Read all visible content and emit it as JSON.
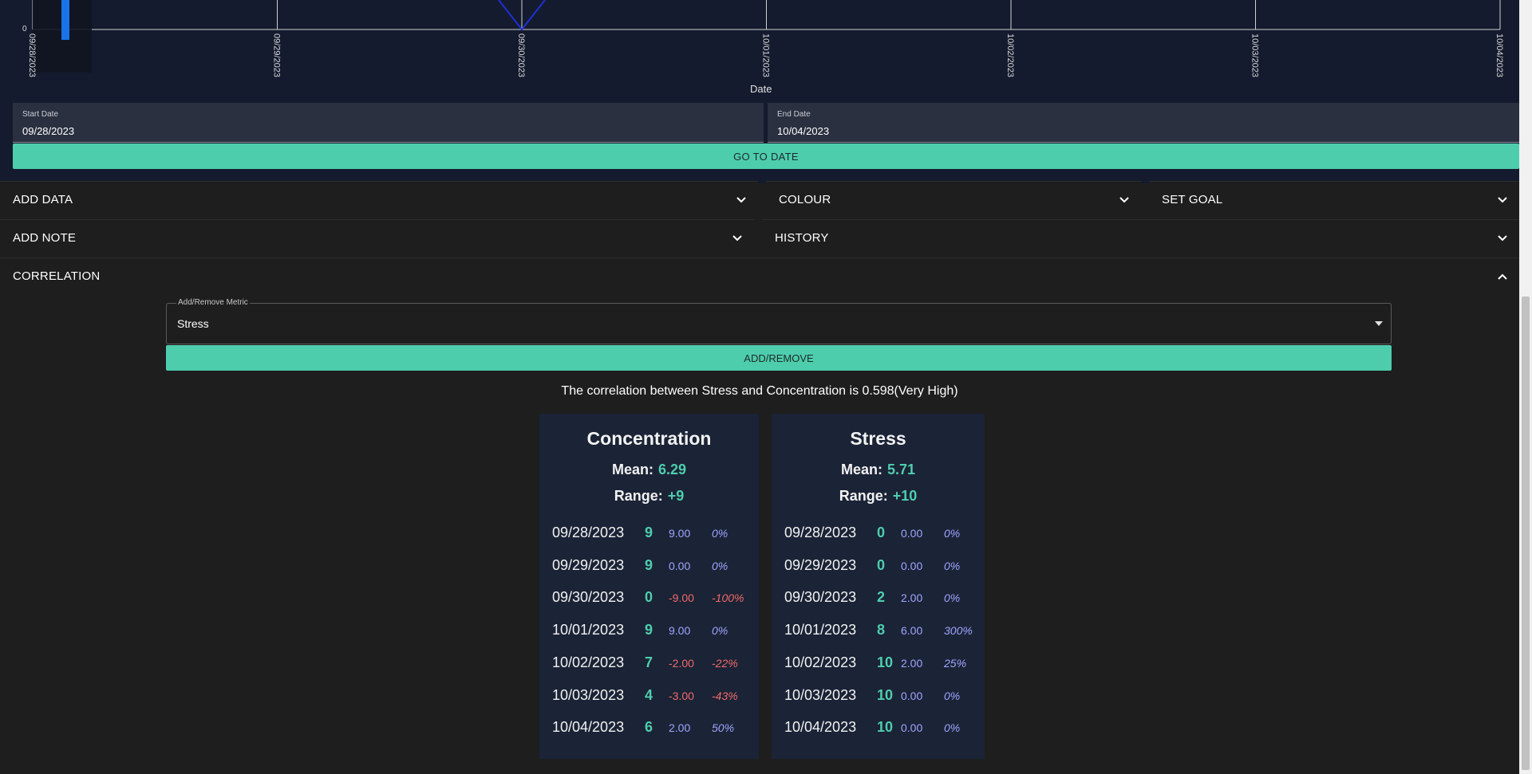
{
  "chart": {
    "zero_label": "0",
    "x_title": "Date",
    "ticks": [
      "09/28/2023",
      "09/29/2023",
      "09/30/2023",
      "10/01/2023",
      "10/02/2023",
      "10/03/2023",
      "10/04/2023"
    ]
  },
  "date_range": {
    "start_label": "Start Date",
    "start_value": "09/28/2023",
    "end_label": "End Date",
    "end_value": "10/04/2023",
    "go_label": "GO TO DATE"
  },
  "accordion": {
    "add_data": "ADD DATA",
    "colour": "COLOUR",
    "set_goal": "SET GOAL",
    "add_note": "ADD NOTE",
    "history": "HISTORY",
    "correlation": "CORRELATION"
  },
  "correlation": {
    "select_label": "Add/Remove Metric",
    "select_value": "Stress",
    "button_label": "ADD/REMOVE",
    "summary": "The correlation between Stress and Concentration is 0.598(Very High)",
    "cards": [
      {
        "title": "Concentration",
        "mean_label": "Mean:",
        "mean": "6.29",
        "range_label": "Range:",
        "range": "+9",
        "rows": [
          {
            "date": "09/28/2023",
            "value": "9",
            "change": "9.00",
            "pct": "0%",
            "neg": false
          },
          {
            "date": "09/29/2023",
            "value": "9",
            "change": "0.00",
            "pct": "0%",
            "neg": false
          },
          {
            "date": "09/30/2023",
            "value": "0",
            "change": "-9.00",
            "pct": "-100%",
            "neg": true
          },
          {
            "date": "10/01/2023",
            "value": "9",
            "change": "9.00",
            "pct": "0%",
            "neg": false
          },
          {
            "date": "10/02/2023",
            "value": "7",
            "change": "-2.00",
            "pct": "-22%",
            "neg": true
          },
          {
            "date": "10/03/2023",
            "value": "4",
            "change": "-3.00",
            "pct": "-43%",
            "neg": true
          },
          {
            "date": "10/04/2023",
            "value": "6",
            "change": "2.00",
            "pct": "50%",
            "neg": false
          }
        ]
      },
      {
        "title": "Stress",
        "mean_label": "Mean:",
        "mean": "5.71",
        "range_label": "Range:",
        "range": "+10",
        "rows": [
          {
            "date": "09/28/2023",
            "value": "0",
            "change": "0.00",
            "pct": "0%",
            "neg": false
          },
          {
            "date": "09/29/2023",
            "value": "0",
            "change": "0.00",
            "pct": "0%",
            "neg": false
          },
          {
            "date": "09/30/2023",
            "value": "2",
            "change": "2.00",
            "pct": "0%",
            "neg": false
          },
          {
            "date": "10/01/2023",
            "value": "8",
            "change": "6.00",
            "pct": "300%",
            "neg": false
          },
          {
            "date": "10/02/2023",
            "value": "10",
            "change": "2.00",
            "pct": "25%",
            "neg": false
          },
          {
            "date": "10/03/2023",
            "value": "10",
            "change": "0.00",
            "pct": "0%",
            "neg": false
          },
          {
            "date": "10/04/2023",
            "value": "10",
            "change": "0.00",
            "pct": "0%",
            "neg": false
          }
        ]
      }
    ]
  },
  "colors": {
    "accent": "#4ecdad",
    "chart_bg": "#141b2e",
    "card_bg": "#1b2336",
    "positive": "#9da6ff",
    "negative": "#f06a6a",
    "bar": "#1a73e8",
    "line": "#1f2fd6"
  },
  "icons": {
    "chevron_down": "chevron-down-icon",
    "chevron_up": "chevron-up-icon",
    "dropdown_caret": "caret-down-icon"
  }
}
